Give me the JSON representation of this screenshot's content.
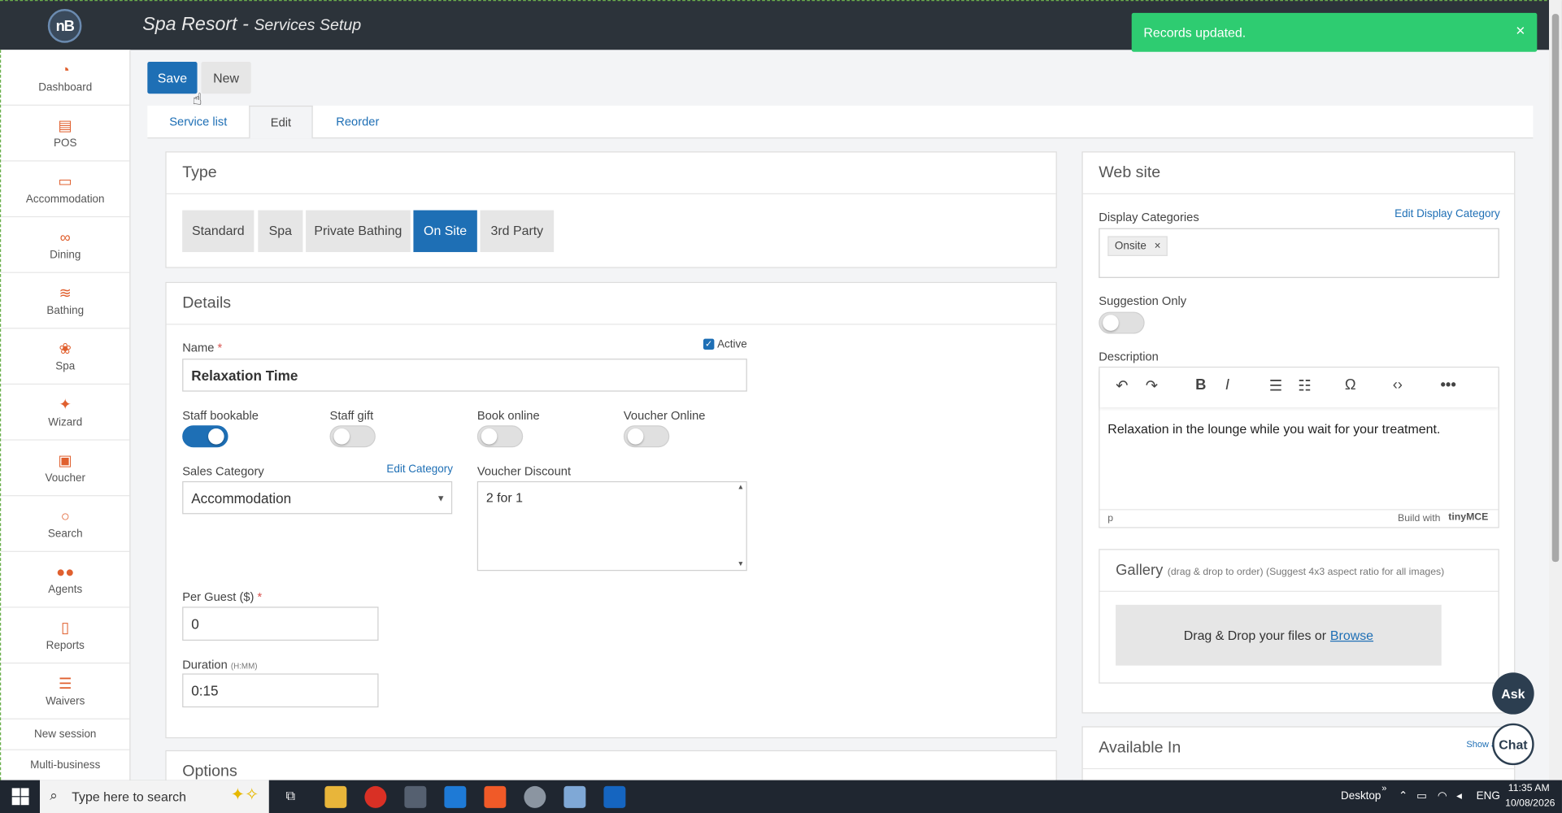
{
  "app": {
    "title": "Spa Resort",
    "title_sep": " - ",
    "subtitle": "Services Setup",
    "logo_text": "nB"
  },
  "toast": {
    "message": "Records updated.",
    "close": "×",
    "color": "#2ecc71"
  },
  "sidebar": {
    "items": [
      {
        "label": "Dashboard",
        "icon": "dashboard-icon"
      },
      {
        "label": "POS",
        "icon": "pos-icon"
      },
      {
        "label": "Accommodation",
        "icon": "bed-icon"
      },
      {
        "label": "Dining",
        "icon": "dining-icon"
      },
      {
        "label": "Bathing",
        "icon": "waves-icon"
      },
      {
        "label": "Spa",
        "icon": "lotus-icon"
      },
      {
        "label": "Wizard",
        "icon": "magic-wand-icon"
      },
      {
        "label": "Voucher",
        "icon": "gift-icon"
      },
      {
        "label": "Search",
        "icon": "search-icon"
      },
      {
        "label": "Agents",
        "icon": "users-icon"
      },
      {
        "label": "Reports",
        "icon": "report-icon"
      },
      {
        "label": "Waivers",
        "icon": "checklist-icon"
      }
    ],
    "new_session": "New session",
    "multi_business": "Multi-business"
  },
  "toolbar": {
    "save_label": "Save",
    "new_label": "New"
  },
  "tabs": [
    "Service list",
    "Edit",
    "Reorder"
  ],
  "type_panel": {
    "title": "Type",
    "options": [
      "Standard",
      "Spa",
      "Private Bathing",
      "On Site",
      "3rd Party"
    ],
    "selected": "On Site"
  },
  "details": {
    "title": "Details",
    "name_label": "Name",
    "required_mark": "*",
    "name_value": "Relaxation Time",
    "active_label": "Active",
    "active_checked": true,
    "toggles": [
      {
        "label": "Staff bookable",
        "on": true
      },
      {
        "label": "Staff gift",
        "on": false
      },
      {
        "label": "Book online",
        "on": false
      },
      {
        "label": "Voucher Online",
        "on": false
      }
    ],
    "sales_category_label": "Sales Category",
    "edit_category": "Edit Category",
    "sales_category_value": "Accommodation",
    "voucher_discount_label": "Voucher Discount",
    "voucher_discount_value": "2 for 1",
    "per_guest_label": "Per Guest ($)",
    "per_guest_value": "0",
    "duration_label": "Duration",
    "duration_hint": "(H:MM)",
    "duration_value": "0:15"
  },
  "options": {
    "title": "Options"
  },
  "website": {
    "title": "Web site",
    "display_categories_label": "Display Categories",
    "edit_display_category": "Edit Display Category",
    "category_chip": "Onsite",
    "chip_remove": "×",
    "suggestion_only_label": "Suggestion Only",
    "suggestion_only_on": false,
    "description_label": "Description",
    "description_text": "Relaxation in the lounge while you wait for your treatment.",
    "editor_path": "p",
    "editor_branding": "Build with",
    "editor_brand": "tinyMCE"
  },
  "gallery": {
    "title": "Gallery",
    "hint": "(drag & drop to order) (Suggest 4x3 aspect ratio for all images)",
    "drop_text": "Drag & Drop your files or",
    "browse": "Browse"
  },
  "available_in": {
    "title": "Available In",
    "show_link": "Show a"
  },
  "fab": {
    "ask": "Ask",
    "chat": "Chat"
  },
  "taskbar": {
    "search_placeholder": "Type here to search",
    "desktop_label": "Desktop",
    "language": "ENG",
    "time": "11:35 AM",
    "date": "10/08/2026"
  }
}
